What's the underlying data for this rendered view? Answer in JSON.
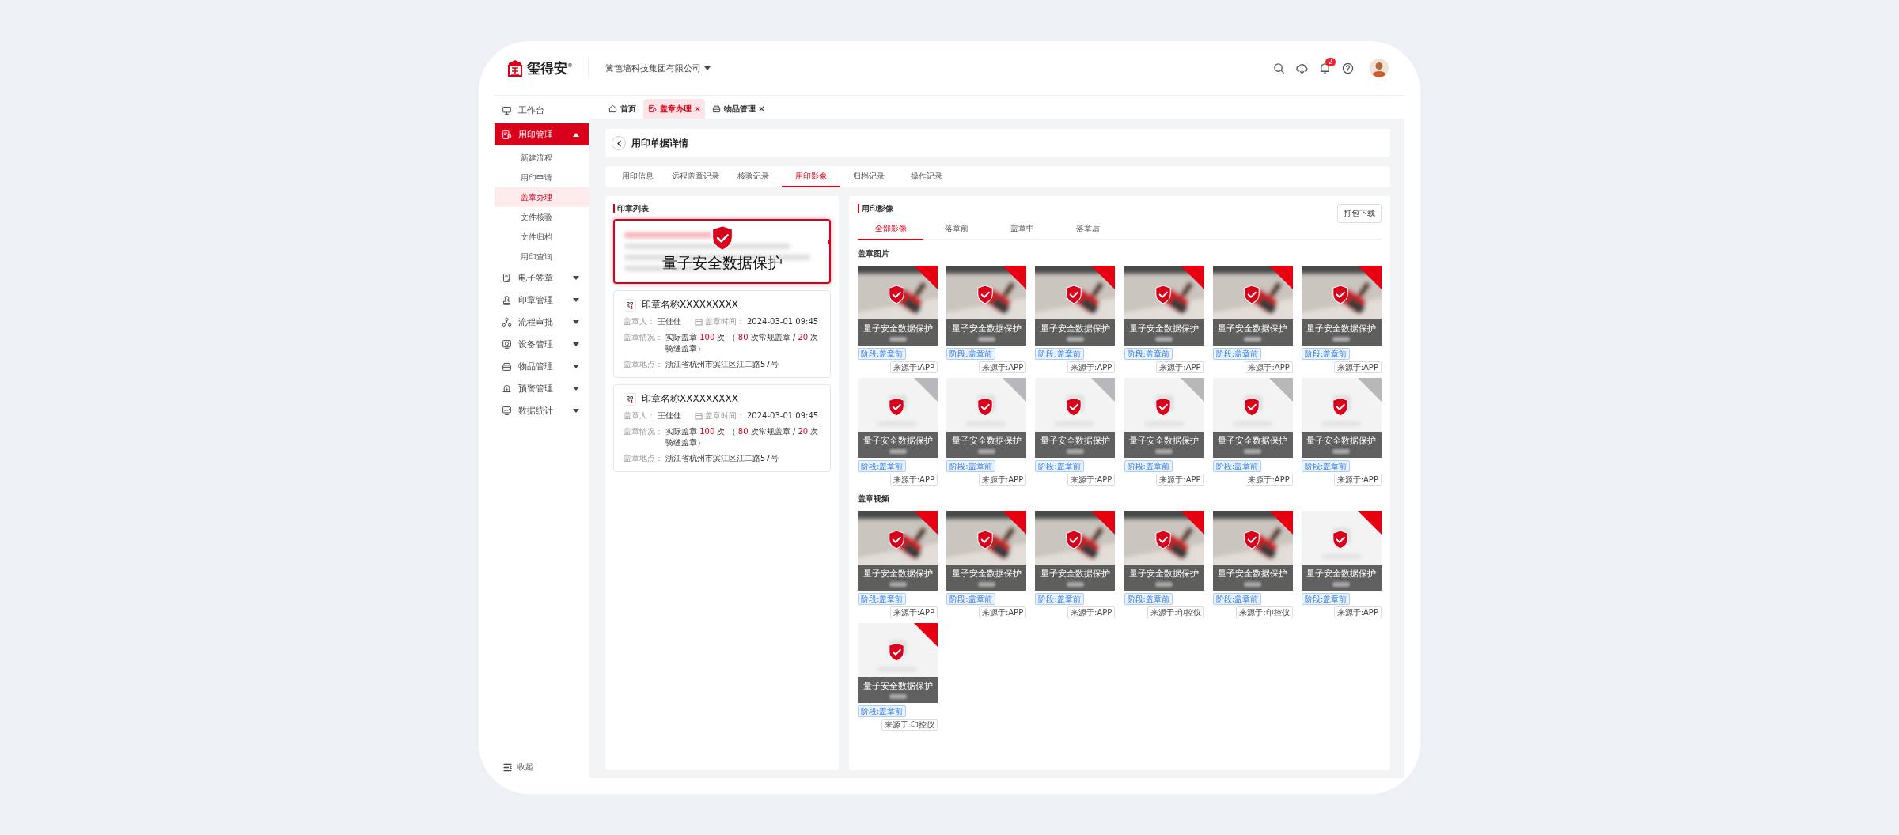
{
  "header": {
    "logo": {
      "name": "玺得安",
      "mark": "®"
    },
    "company": "篱笆墙科技集团有限公司",
    "notifications": "2"
  },
  "sidebar": {
    "items": [
      {
        "label": "工作台",
        "selected": false
      },
      {
        "label": "用印管理",
        "selected": true,
        "expanded": true,
        "children": [
          {
            "label": "新建流程",
            "selected": false
          },
          {
            "label": "用印申请",
            "selected": false
          },
          {
            "label": "盖章办理",
            "selected": true
          },
          {
            "label": "文件核验",
            "selected": false
          },
          {
            "label": "文件归档",
            "selected": false
          },
          {
            "label": "用印查询",
            "selected": false
          }
        ]
      },
      {
        "label": "电子签章",
        "selected": false,
        "expanded": false
      },
      {
        "label": "印章管理",
        "selected": false,
        "expanded": false
      },
      {
        "label": "流程审批",
        "selected": false,
        "expanded": false
      },
      {
        "label": "设备管理",
        "selected": false,
        "expanded": false
      },
      {
        "label": "物品管理",
        "selected": false,
        "expanded": false
      },
      {
        "label": "预警管理",
        "selected": false,
        "expanded": false
      },
      {
        "label": "数据统计",
        "selected": false,
        "expanded": false
      }
    ],
    "collapse": "收起"
  },
  "tabs": [
    {
      "label": "首页",
      "selected": false,
      "closable": false
    },
    {
      "label": "盖章办理",
      "selected": true,
      "closable": true
    },
    {
      "label": "物品管理",
      "selected": false,
      "closable": true
    }
  ],
  "page": {
    "title": "用印单据详情"
  },
  "detail_tabs": [
    {
      "label": "用印信息",
      "selected": false
    },
    {
      "label": "远程盖章记录",
      "selected": false
    },
    {
      "label": "核验记录",
      "selected": false
    },
    {
      "label": "用印影像",
      "selected": true
    },
    {
      "label": "归档记录",
      "selected": false
    },
    {
      "label": "操作记录",
      "selected": false
    }
  ],
  "seal_list": {
    "title": "印章列表",
    "cards": [
      {
        "selected": true,
        "blurred": true,
        "overlay": "量子安全数据保护"
      },
      {
        "selected": false,
        "blurred": false,
        "name": "印章名称XXXXXXXXX",
        "operator_label": "盖章人：",
        "operator": "王佳佳",
        "time_label": "盖章时间：",
        "time": "2024-03-01 09:45",
        "usage_label": "盖章情况：",
        "usage": [
          {
            "text": "实际盖章 ",
            "highlight": false
          },
          {
            "text": "100",
            "highlight": true
          },
          {
            "text": " 次 （ ",
            "highlight": false
          },
          {
            "text": "80",
            "highlight": true
          },
          {
            "text": " 次常规盖章 / ",
            "highlight": false
          },
          {
            "text": "20",
            "highlight": true
          },
          {
            "text": " 次骑缝盖章）",
            "highlight": false
          }
        ],
        "location_label": "盖章地点：",
        "location": "浙江省杭州市滨江区江二路57号"
      },
      {
        "selected": false,
        "blurred": false,
        "name": "印章名称XXXXXXXXX",
        "operator_label": "盖章人：",
        "operator": "王佳佳",
        "time_label": "盖章时间：",
        "time": "2024-03-01 09:45",
        "usage_label": "盖章情况：",
        "usage": [
          {
            "text": "实际盖章 ",
            "highlight": false
          },
          {
            "text": "100",
            "highlight": true
          },
          {
            "text": " 次 （ ",
            "highlight": false
          },
          {
            "text": "80",
            "highlight": true
          },
          {
            "text": " 次常规盖章 / ",
            "highlight": false
          },
          {
            "text": "20",
            "highlight": true
          },
          {
            "text": " 次骑缝盖章）",
            "highlight": false
          }
        ],
        "location_label": "盖章地点：",
        "location": "浙江省杭州市滨江区江二路57号"
      }
    ]
  },
  "images": {
    "title": "用印影像",
    "download": "打包下载",
    "tabs": [
      {
        "label": "全部影像",
        "selected": true
      },
      {
        "label": "落章前",
        "selected": false
      },
      {
        "label": "盖章中",
        "selected": false
      },
      {
        "label": "落章后",
        "selected": false
      }
    ],
    "sections": [
      {
        "title": "盖章图片",
        "items": [
          {
            "color": "#e60012",
            "overlay": "量子安全数据保护",
            "stage": "阶段:盖章前",
            "source": "来源于:APP"
          },
          {
            "color": "#e60012",
            "overlay": "量子安全数据保护",
            "stage": "阶段:盖章前",
            "source": "来源于:APP"
          },
          {
            "color": "#e60012",
            "overlay": "量子安全数据保护",
            "stage": "阶段:盖章前",
            "source": "来源于:APP"
          },
          {
            "color": "#e60012",
            "overlay": "量子安全数据保护",
            "stage": "阶段:盖章前",
            "source": "来源于:APP"
          },
          {
            "color": "#e60012",
            "overlay": "量子安全数据保护",
            "stage": "阶段:盖章前",
            "source": "来源于:APP"
          },
          {
            "color": "#e60012",
            "overlay": "量子安全数据保护",
            "stage": "阶段:盖章前",
            "source": "来源于:APP"
          },
          {
            "kind": "placeholder",
            "color": "#b8b8bc",
            "overlay": "量子安全数据保护",
            "stage": "阶段:盖章前",
            "source": "来源于:APP"
          },
          {
            "kind": "placeholder",
            "color": "#b8b8bc",
            "overlay": "量子安全数据保护",
            "stage": "阶段:盖章前",
            "source": "来源于:APP"
          },
          {
            "kind": "placeholder",
            "color": "#b8b8bc",
            "overlay": "量子安全数据保护",
            "stage": "阶段:盖章前",
            "source": "来源于:APP"
          },
          {
            "kind": "placeholder",
            "color": "#b8b8bc",
            "overlay": "量子安全数据保护",
            "stage": "阶段:盖章前",
            "source": "来源于:APP"
          },
          {
            "kind": "placeholder",
            "color": "#b8b8bc",
            "overlay": "量子安全数据保护",
            "stage": "阶段:盖章前",
            "source": "来源于:APP"
          },
          {
            "kind": "placeholder",
            "color": "#b8b8bc",
            "overlay": "量子安全数据保护",
            "stage": "阶段:盖章前",
            "source": "来源于:APP"
          }
        ]
      },
      {
        "title": "盖章视频",
        "items": [
          {
            "color": "#e60012",
            "overlay": "量子安全数据保护",
            "stage": "阶段:盖章前",
            "source": "来源于:APP"
          },
          {
            "color": "#e60012",
            "overlay": "量子安全数据保护",
            "stage": "阶段:盖章前",
            "source": "来源于:APP"
          },
          {
            "color": "#e60012",
            "overlay": "量子安全数据保护",
            "stage": "阶段:盖章前",
            "source": "来源于:APP"
          },
          {
            "color": "#e60012",
            "overlay": "量子安全数据保护",
            "stage": "阶段:盖章前",
            "source": "来源于:印控仪"
          },
          {
            "color": "#e60012",
            "overlay": "量子安全数据保护",
            "stage": "阶段:盖章前",
            "source": "来源于:印控仪"
          },
          {
            "kind": "placeholder",
            "color": "#e60012",
            "overlay": "量子安全数据保护",
            "stage": "阶段:盖章前",
            "source": "来源于:APP"
          },
          {
            "kind": "placeholder",
            "color": "#e60012",
            "overlay": "量子安全数据保护",
            "stage": "阶段:盖章前",
            "source": "来源于:印控仪"
          }
        ]
      }
    ]
  }
}
